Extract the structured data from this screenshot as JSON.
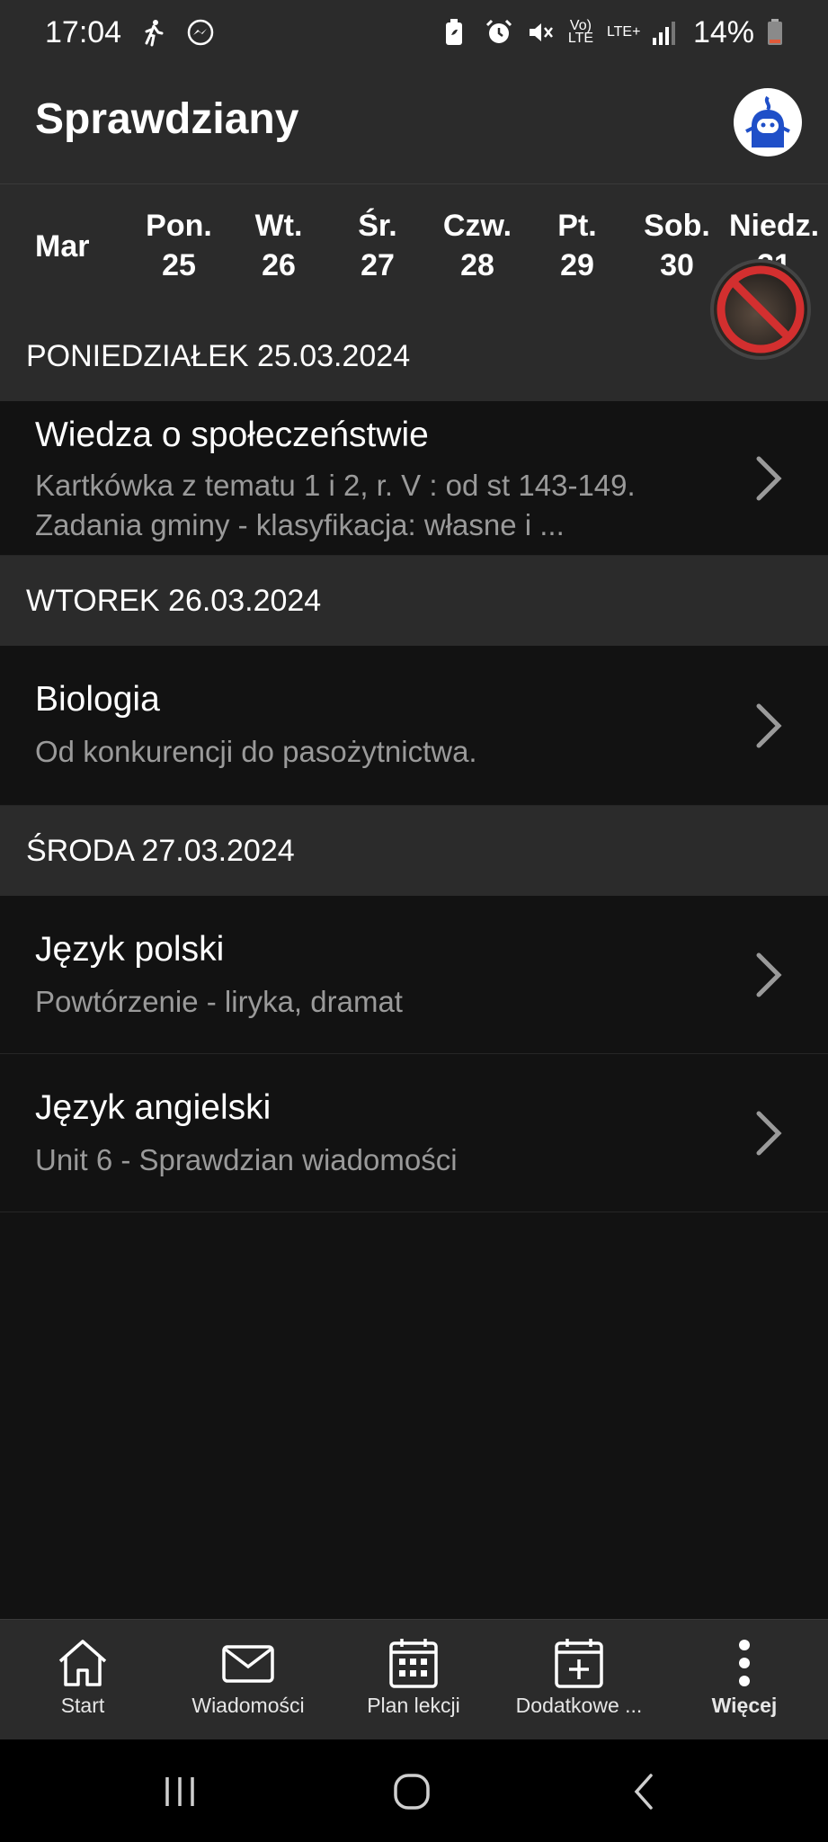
{
  "status_bar": {
    "time": "17:04",
    "volte": "Vo) LTE",
    "lte": "LTE+",
    "battery": "14%",
    "icons": [
      "walking-icon",
      "messenger-icon",
      "battery-saver-icon",
      "alarm-icon",
      "mute-icon",
      "signal-icon",
      "battery-low-icon"
    ],
    "battery_color": "#e05a3a"
  },
  "header": {
    "title": "Sprawdziany",
    "avatar_icon": "mascot-avatar-icon"
  },
  "week": {
    "month": "Mar",
    "days": [
      {
        "name": "Pon.",
        "date": "25"
      },
      {
        "name": "Wt.",
        "date": "26"
      },
      {
        "name": "Śr.",
        "date": "27"
      },
      {
        "name": "Czw.",
        "date": "28"
      },
      {
        "name": "Pt.",
        "date": "29"
      },
      {
        "name": "Sob.",
        "date": "30"
      },
      {
        "name": "Niedz.",
        "date": "31"
      }
    ]
  },
  "sections": [
    {
      "header": "PONIEDZIAŁEK 25.03.2024",
      "items": [
        {
          "title": "Wiedza o społeczeństwie",
          "description": "Kartkówka z tematu 1 i 2, r. V : od st 143-149.\nZadania gminy -  klasyfikacja: własne i ..."
        }
      ]
    },
    {
      "header": "WTOREK 26.03.2024",
      "items": [
        {
          "title": "Biologia",
          "description": "Od konkurencji do pasożytnictwa."
        }
      ]
    },
    {
      "header": "ŚRODA 27.03.2024",
      "items": [
        {
          "title": "Język polski",
          "description": "Powtórzenie - liryka, dramat"
        },
        {
          "title": "Język angielski",
          "description": "Unit 6 - Sprawdzian wiadomości"
        }
      ]
    }
  ],
  "bottom_nav": [
    {
      "label": "Start",
      "icon": "home-icon"
    },
    {
      "label": "Wiadomości",
      "icon": "mail-icon"
    },
    {
      "label": "Plan lekcji",
      "icon": "calendar-grid-icon"
    },
    {
      "label": "Dodatkowe ...",
      "icon": "calendar-add-icon"
    },
    {
      "label": "Więcej",
      "icon": "more-vertical-icon"
    }
  ],
  "system_nav": [
    "recents-icon",
    "home-circle-icon",
    "back-icon"
  ],
  "colors": {
    "background": "#121212",
    "surface": "#2b2b2b",
    "accent_avatar": "#1f4fc8",
    "blocked_red": "#d32f2f"
  }
}
